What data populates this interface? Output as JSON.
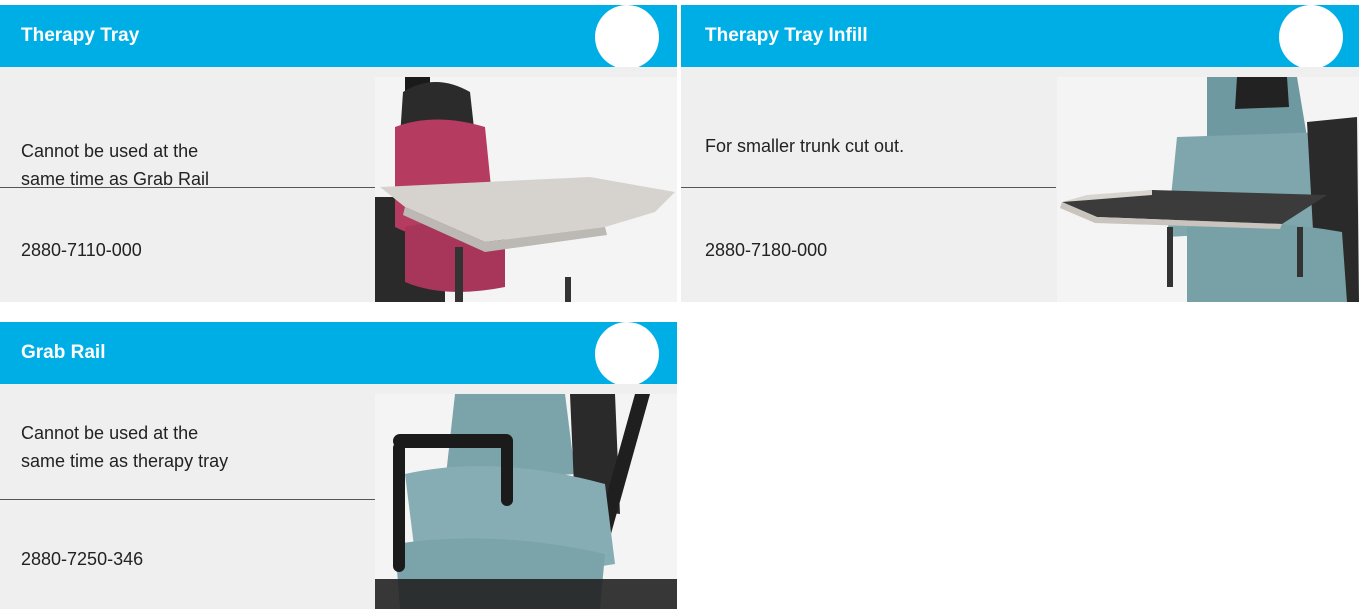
{
  "colors": {
    "header": "#00aee6",
    "panel": "#efeff0",
    "text": "#222222"
  },
  "cards": [
    {
      "title": "Therapy Tray",
      "description_line1": "Cannot be used at the",
      "description_line2": "same time as Grab Rail",
      "code": "2880-7110-000"
    },
    {
      "title": "Therapy Tray Infill",
      "description_line1": "For smaller trunk cut out.",
      "code": "2880-7180-000"
    },
    {
      "title": "Grab Rail",
      "description_line1": "Cannot be used at the",
      "description_line2": "same time as therapy tray",
      "code": "2880-7250-346"
    }
  ]
}
